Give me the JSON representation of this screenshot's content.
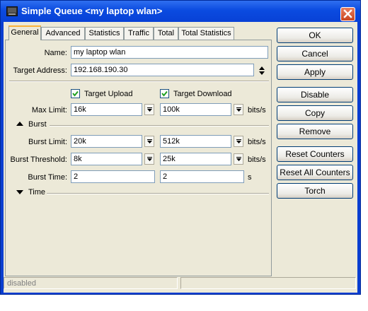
{
  "window": {
    "title": "Simple Queue <my laptop wlan>"
  },
  "tabs": [
    "General",
    "Advanced",
    "Statistics",
    "Traffic",
    "Total",
    "Total Statistics"
  ],
  "general": {
    "name_label": "Name:",
    "name_value": "my laptop wlan",
    "target_label": "Target Address:",
    "target_value": "192.168.190.30",
    "target_upload_label": "Target Upload",
    "target_upload_checked": true,
    "target_download_label": "Target Download",
    "target_download_checked": true,
    "max_limit_label": "Max Limit:",
    "max_limit_upload": "16k",
    "max_limit_download": "100k",
    "unit_bits": "bits/s",
    "unit_s": "s",
    "burst_section": "Burst",
    "burst_limit_label": "Burst Limit:",
    "burst_limit_upload": "20k",
    "burst_limit_download": "512k",
    "burst_threshold_label": "Burst Threshold:",
    "burst_threshold_upload": "8k",
    "burst_threshold_download": "25k",
    "burst_time_label": "Burst Time:",
    "burst_time_upload": "2",
    "burst_time_download": "2",
    "time_section": "Time"
  },
  "buttons": {
    "ok": "OK",
    "cancel": "Cancel",
    "apply": "Apply",
    "disable": "Disable",
    "copy": "Copy",
    "remove": "Remove",
    "reset_counters": "Reset Counters",
    "reset_all_counters": "Reset All Counters",
    "torch": "Torch"
  },
  "status": {
    "state": "disabled"
  }
}
